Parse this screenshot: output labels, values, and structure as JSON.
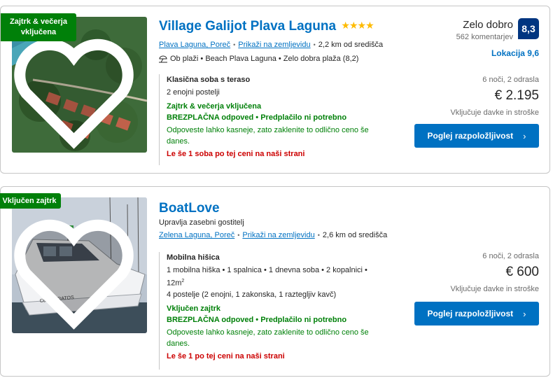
{
  "listings": [
    {
      "badge": "Zajtrk & večerja vključena",
      "title": "Village Galijot Plava Laguna",
      "stars": "★★★★",
      "area_link": "Plava Laguna, Poreč",
      "map_link": "Prikaži na zemljevidu",
      "distance": "2,2 km od središča",
      "beach_line": "Ob plaži • Beach Plava Laguna • Zelo dobra plaža (8,2)",
      "score_word": "Zelo dobro",
      "score": "8,3",
      "reviews": "562 komentarjev",
      "location_score": "Lokacija 9,6",
      "room_name": "Klasična soba s teraso",
      "room_desc": "2 enojni postelji",
      "meal": "Zajtrk & večerja vključena",
      "cancel": "BREZPLAČNA odpoved • Predplačilo ni potrebno",
      "cancel_note": "Odpoveste lahko kasneje, zato zaklenite to odlično ceno še danes.",
      "scarcity": "Le še 1 soba po tej ceni na naši strani",
      "stay": "6 noči, 2 odrasla",
      "price": "€ 2.195",
      "taxes": "Vključuje davke in stroške",
      "cta": "Poglej razpoložljivost"
    },
    {
      "badge": "Vključen zajtrk",
      "title": "BoatLove",
      "host": "Upravlja zasebni gostitelj",
      "area_link": "Zelena Laguna, Poreč",
      "map_link": "Prikaži na zemljevidu",
      "distance": "2,6 km od središča",
      "room_name": "Mobilna hišica",
      "room_desc_1": "1 mobilna hiška • 1 spalnica • 1 dnevna soba • 2 kopalnici •",
      "room_desc_2": "12m",
      "room_desc_2_sup": "2",
      "room_beds": "4 postelje (2 enojni, 1 zakonska, 1 raztegljiv kavč)",
      "meal": "Vključen zajtrk",
      "cancel": "BREZPLAČNA odpoved • Predplačilo ni potrebno",
      "cancel_note": "Odpoveste lahko kasneje, zato zaklenite to odlično ceno še danes.",
      "scarcity": "Le še 1 po tej ceni na naši strani",
      "stay": "6 noči, 2 odrasla",
      "price": "€ 600",
      "taxes": "Vključuje davke in stroške",
      "cta": "Poglej razpoložljivost"
    }
  ],
  "icons": {
    "heart": "heart-icon",
    "beach": "beach-umbrella-icon",
    "chevron": "chevron-right-icon"
  },
  "colors": {
    "link": "#0071c2",
    "green": "#008009",
    "red": "#cc0000",
    "score": "#003580",
    "star": "#febb02"
  }
}
